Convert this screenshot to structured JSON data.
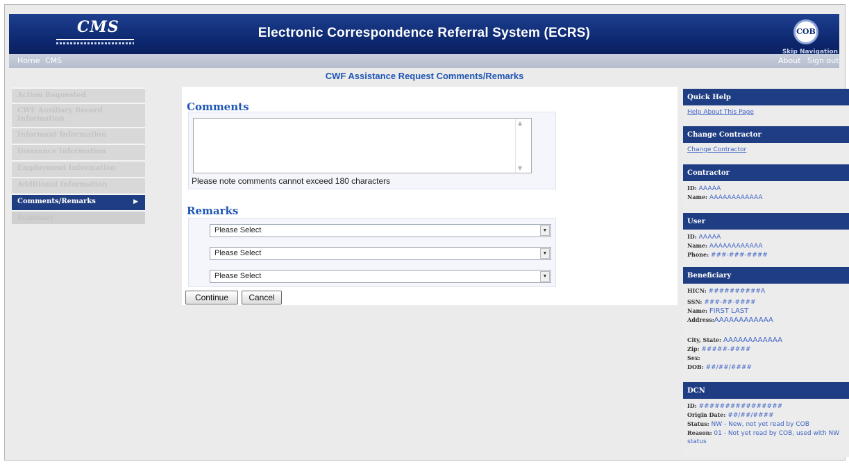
{
  "header": {
    "title": "Electronic Correspondence Referral System (ECRS)",
    "cms_logo": "CMS",
    "cob_logo": "COB",
    "skip_nav": "Skip Navigation"
  },
  "navbar": {
    "home": "Home",
    "cms": "CMS",
    "about": "About",
    "signout": "Sign out"
  },
  "page_title": "CWF Assistance Request Comments/Remarks",
  "leftnav": {
    "items": [
      {
        "label": "Action Requested"
      },
      {
        "label": "CWF Auxiliary Record Information"
      },
      {
        "label": "Informant Information"
      },
      {
        "label": "Insurance Information"
      },
      {
        "label": "Employment Information"
      },
      {
        "label": "Additional Information"
      },
      {
        "label": "Comments/Remarks"
      },
      {
        "label": "Summary"
      }
    ]
  },
  "comments": {
    "heading": "Comments",
    "textarea_value": "",
    "note": "Please note comments cannot exceed 180 characters"
  },
  "remarks": {
    "heading": "Remarks",
    "selects": [
      "Please Select",
      "Please Select",
      "Please Select"
    ]
  },
  "buttons": {
    "continue": "Continue",
    "cancel": "Cancel"
  },
  "sidebar": {
    "quick_help": {
      "title": "Quick Help",
      "link": "Help About This Page"
    },
    "change_contractor": {
      "title": "Change Contractor",
      "link": "Change Contractor"
    },
    "contractor": {
      "title": "Contractor",
      "id_label": "ID:",
      "id": "AAAAA",
      "name_label": "Name:",
      "name": "AAAAAAAAAAAA"
    },
    "user": {
      "title": "User",
      "id_label": "ID:",
      "id": "AAAAA",
      "name_label": "Name:",
      "name": "AAAAAAAAAAAA",
      "phone_label": "Phone:",
      "phone": "###-###-####"
    },
    "beneficiary": {
      "title": "Beneficiary",
      "hicn_label": "HICN:",
      "hicn": "##########A",
      "ssn_label": "SSN:",
      "ssn": "###-##-####",
      "name_label": "Name:",
      "name": "FIRST LAST",
      "address_label": "Address:",
      "address": "AAAAAAAAAAAA",
      "city_label": "City, State:",
      "city": "AAAAAAAAAAAA",
      "zip_label": "Zip:",
      "zip": "#####-####",
      "sex_label": "Sex:",
      "sex": "",
      "dob_label": "DOB:",
      "dob": "##/##/####"
    },
    "dcn": {
      "title": "DCN",
      "id_label": "ID:",
      "id": "################",
      "origin_label": "Origin Date:",
      "origin": "##/##/####",
      "status_label": "Status:",
      "status": "NW - New, not yet read by COB",
      "reason_label": "Reason:",
      "reason": "01 - Not yet read by COB, used with NW status"
    }
  }
}
